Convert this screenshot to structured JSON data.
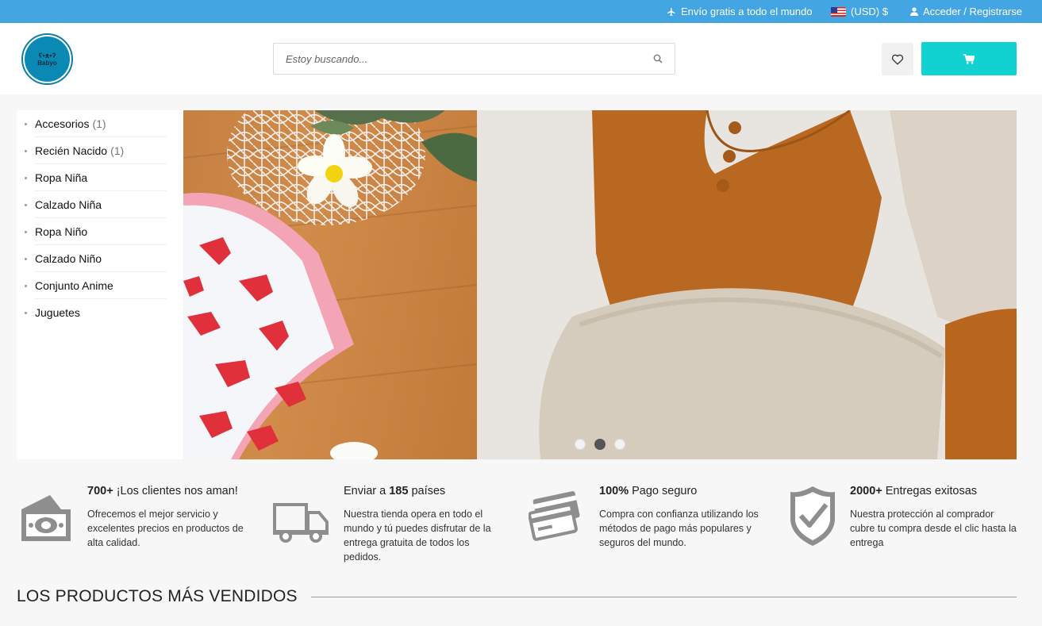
{
  "topbar": {
    "shipping": "Envío gratis a todo el mundo",
    "currency": "(USD) $",
    "account": "Acceder / Registrarse"
  },
  "header": {
    "logo_text": "Babyo",
    "search_placeholder": "Estoy buscando...",
    "colors": {
      "topbar": "#43a6e2",
      "cart_button": "#12d1d1"
    }
  },
  "sidebar": {
    "items": [
      {
        "label": "Accesorios",
        "count": "(1)"
      },
      {
        "label": "Recién Nacido",
        "count": "(1)"
      },
      {
        "label": "Ropa Niña",
        "count": ""
      },
      {
        "label": "Calzado Niña",
        "count": ""
      },
      {
        "label": "Ropa Niño",
        "count": ""
      },
      {
        "label": "Calzado Niño",
        "count": ""
      },
      {
        "label": "Conjunto Anime",
        "count": ""
      },
      {
        "label": "Juguetes",
        "count": ""
      }
    ]
  },
  "slider": {
    "slides": 3,
    "active": 2
  },
  "features": [
    {
      "icon": "money-icon",
      "title_bold": "700+",
      "title_rest": " ¡Los clientes nos aman!",
      "desc": "Ofrecemos el mejor servicio y excelentes precios en productos de alta calidad."
    },
    {
      "icon": "truck-icon",
      "title_pre": "Enviar a ",
      "title_bold": "185",
      "title_rest": " países",
      "desc": "Nuestra tienda opera en todo el mundo y tú puedes disfrutar de la entrega gratuita de todos los pedidos."
    },
    {
      "icon": "credit-card-icon",
      "title_bold": "100%",
      "title_rest": " Pago seguro",
      "desc": "Compra con confianza utilizando los métodos de pago más populares y seguros del mundo."
    },
    {
      "icon": "shield-check-icon",
      "title_bold": "2000+",
      "title_rest": " Entregas exitosas",
      "desc": "Nuestra protección al comprador cubre tu compra desde el clic hasta la entrega"
    }
  ],
  "section": {
    "title": "LOS PRODUCTOS MÁS VENDIDOS"
  }
}
